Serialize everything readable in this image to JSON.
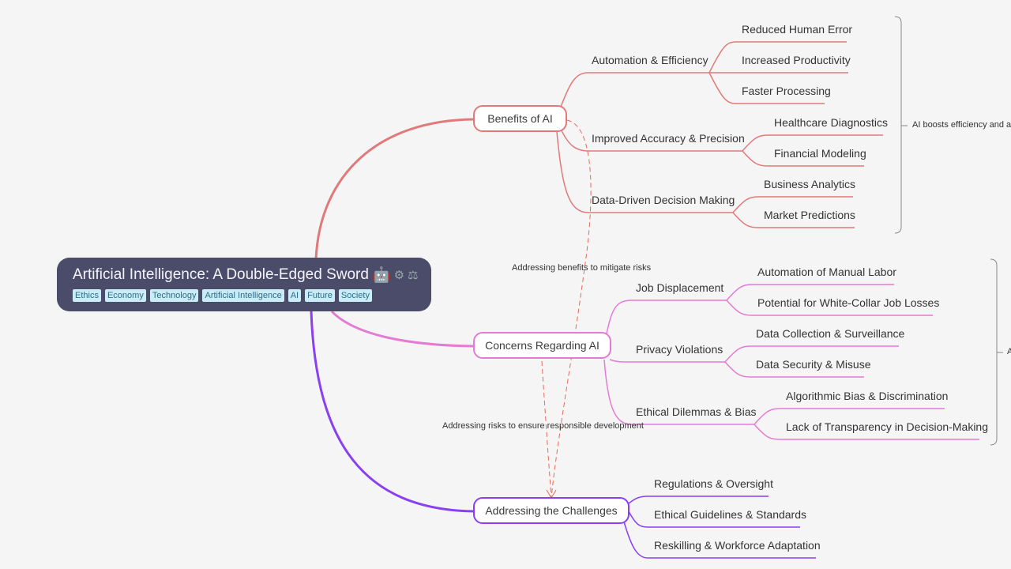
{
  "root": {
    "title": "Artificial Intelligence: A Double-Edged Sword",
    "emoji_icons": [
      "robot-icon",
      "gear-icon",
      "scales-icon"
    ],
    "tags": [
      "Ethics",
      "Economy",
      "Technology",
      "Artificial Intelligence",
      "AI",
      "Future",
      "Society"
    ]
  },
  "colors": {
    "benefits": "#e07a7a",
    "concerns": "#e47ad4",
    "challenges": "#8a3ff0",
    "root_bg": "#4a4c6a",
    "tag_bg": "#c9ecf7"
  },
  "topics": [
    {
      "label": "Benefits of AI",
      "subtopics": [
        {
          "label": "Automation & Efficiency",
          "children": [
            "Reduced Human Error",
            "Increased Productivity",
            "Faster Processing"
          ]
        },
        {
          "label": "Improved Accuracy & Precision",
          "children": [
            "Healthcare Diagnostics",
            "Financial Modeling"
          ]
        },
        {
          "label": "Data-Driven Decision Making",
          "children": [
            "Business Analytics",
            "Market Predictions"
          ]
        }
      ],
      "summary": "AI boosts efficiency and a"
    },
    {
      "label": "Concerns Regarding AI",
      "subtopics": [
        {
          "label": "Job Displacement",
          "children": [
            "Automation of Manual Labor",
            "Potential for White-Collar Job Losses"
          ]
        },
        {
          "label": "Privacy Violations",
          "children": [
            "Data Collection & Surveillance",
            "Data Security & Misuse"
          ]
        },
        {
          "label": "Ethical Dilemmas & Bias",
          "children": [
            "Algorithmic Bias & Discrimination",
            "Lack of Transparency in Decision-Making"
          ]
        }
      ],
      "summary": "A"
    },
    {
      "label": "Addressing the Challenges",
      "subtopics": [
        {
          "label": "Regulations & Oversight",
          "children": []
        },
        {
          "label": "Ethical Guidelines & Standards",
          "children": []
        },
        {
          "label": "Reskilling & Workforce Adaptation",
          "children": []
        }
      ]
    }
  ],
  "relationships": [
    {
      "label": "Addressing benefits to mitigate risks",
      "from": "Benefits of AI",
      "to": "Addressing the Challenges"
    },
    {
      "label": "Addressing risks to ensure responsible development",
      "from": "Concerns Regarding AI",
      "to": "Addressing the Challenges"
    }
  ]
}
